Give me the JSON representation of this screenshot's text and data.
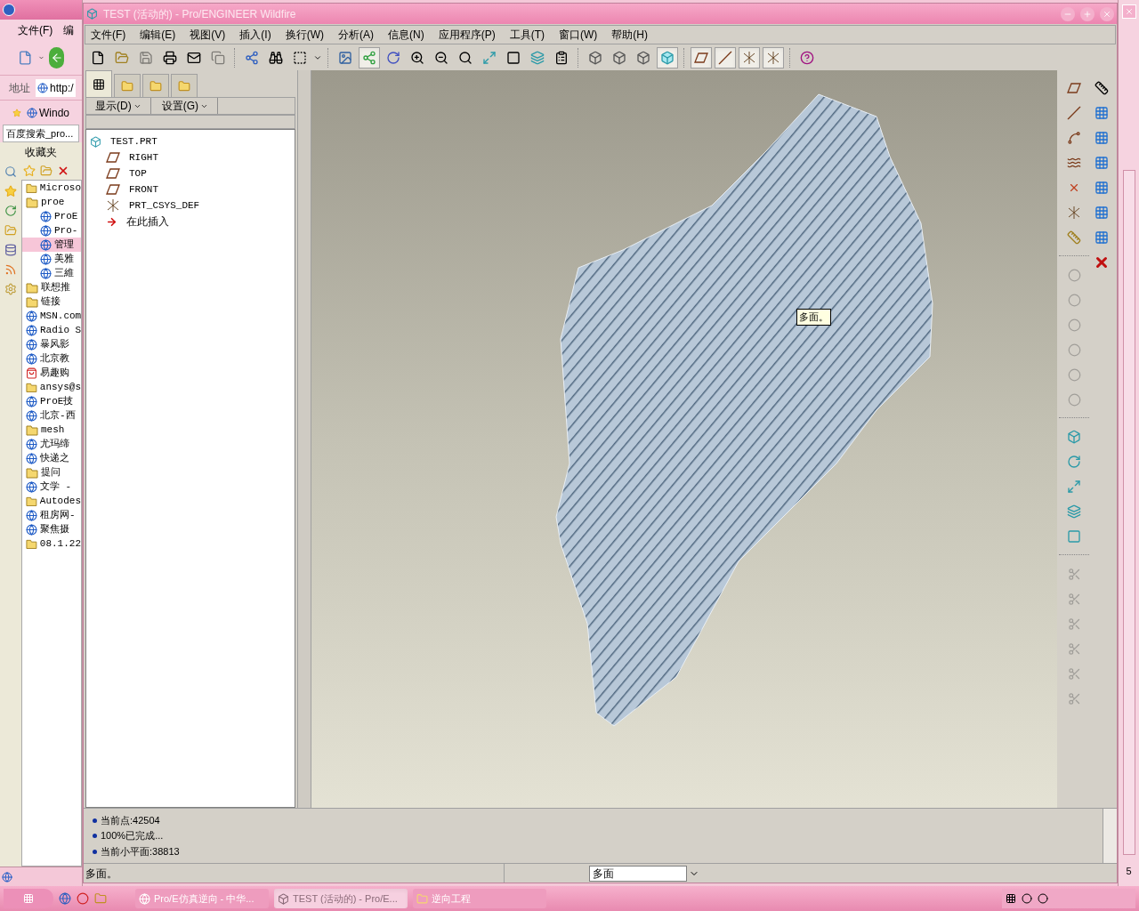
{
  "browser": {
    "menu": [
      "文件(F)",
      "编"
    ],
    "address_label": "地址",
    "address_value": "http:/",
    "links_item": "Windo",
    "search_value": "百度搜索_pro...",
    "favorites_title": "收藏夹",
    "favorites": [
      {
        "label": "Microso",
        "kind": "folder",
        "selected": false
      },
      {
        "label": "proe",
        "kind": "folder",
        "selected": false,
        "children": [
          {
            "label": "ProE",
            "kind": "page",
            "selected": false
          },
          {
            "label": "Pro-",
            "kind": "page",
            "selected": false
          },
          {
            "label": "管理",
            "kind": "page",
            "selected": true
          },
          {
            "label": "美雅",
            "kind": "page",
            "selected": false
          },
          {
            "label": "三維",
            "kind": "page",
            "selected": false
          }
        ]
      },
      {
        "label": "联想推",
        "kind": "folder",
        "selected": false
      },
      {
        "label": "链接",
        "kind": "folder",
        "selected": false
      },
      {
        "label": "MSN.com",
        "kind": "page",
        "selected": false
      },
      {
        "label": "Radio S",
        "kind": "page",
        "selected": false
      },
      {
        "label": "暴风影",
        "kind": "page",
        "selected": false
      },
      {
        "label": "北京教",
        "kind": "page",
        "selected": false
      },
      {
        "label": "易趣购",
        "kind": "shop",
        "selected": false
      },
      {
        "label": "ansys@s",
        "kind": "folder",
        "selected": false
      },
      {
        "label": "ProE技",
        "kind": "page",
        "selected": false
      },
      {
        "label": "北京-西",
        "kind": "page",
        "selected": false
      },
      {
        "label": "mesh",
        "kind": "folder",
        "selected": false
      },
      {
        "label": "尤玛缔",
        "kind": "page",
        "selected": false
      },
      {
        "label": "快递之",
        "kind": "page",
        "selected": false
      },
      {
        "label": "提问",
        "kind": "folder",
        "selected": false
      },
      {
        "label": "文学 -",
        "kind": "page",
        "selected": false
      },
      {
        "label": "Autodes",
        "kind": "folder",
        "selected": false
      },
      {
        "label": "租房网-",
        "kind": "page",
        "selected": false
      },
      {
        "label": "聚焦摄",
        "kind": "page",
        "selected": false
      },
      {
        "label": "08.1.22",
        "kind": "folder",
        "selected": false
      }
    ]
  },
  "window": {
    "title": "TEST (活动的) - Pro/ENGINEER Wildfire"
  },
  "menu": [
    "文件(F)",
    "编辑(E)",
    "视图(V)",
    "插入(I)",
    "换行(W)",
    "分析(A)",
    "信息(N)",
    "应用程序(P)",
    "工具(T)",
    "窗口(W)",
    "帮助(H)"
  ],
  "display_style": [
    {
      "selected": false
    },
    {
      "selected": false
    },
    {
      "selected": false
    },
    {
      "selected": true
    }
  ],
  "datum_display": [
    {
      "selected": true
    },
    {
      "selected": true
    },
    {
      "selected": true
    },
    {
      "selected": true
    }
  ],
  "navigator_tabs": [
    {
      "selected": true
    },
    {
      "selected": false
    },
    {
      "selected": false
    },
    {
      "selected": false
    }
  ],
  "tree_menus": [
    "显示(D)",
    "设置(G)"
  ],
  "model_tree": {
    "label": "TEST.PRT",
    "kind": "part",
    "children": [
      {
        "label": "RIGHT",
        "kind": "plane"
      },
      {
        "label": "TOP",
        "kind": "plane"
      },
      {
        "label": "FRONT",
        "kind": "plane"
      },
      {
        "label": "PRT_CSYS_DEF",
        "kind": "csys"
      },
      {
        "label": "在此插入",
        "kind": "insert"
      }
    ]
  },
  "viewport": {
    "tooltip": "多面。"
  },
  "feature_tools": [
    {
      "disabled": true
    },
    {
      "disabled": true
    },
    {
      "disabled": true
    },
    {
      "disabled": true
    },
    {
      "disabled": true
    },
    {
      "disabled": true
    }
  ],
  "edit_tools": [
    {
      "disabled": true
    },
    {
      "disabled": true
    },
    {
      "disabled": true
    },
    {
      "disabled": true
    },
    {
      "disabled": true
    },
    {
      "disabled": true
    }
  ],
  "messages": [
    "当前点:42504",
    "100%已完成...",
    "当前小平面:38813"
  ],
  "status_bar": {
    "text": "多面。",
    "filter": "多面",
    "page": "5"
  },
  "taskbar": [
    {
      "label": "Pro/E仿真逆向 - 中华...",
      "kind": "browser",
      "selected": false
    },
    {
      "label": "TEST (活动的) - Pro/E...",
      "kind": "proe",
      "selected": true
    },
    {
      "label": "逆向工程",
      "kind": "folder",
      "selected": false
    }
  ]
}
